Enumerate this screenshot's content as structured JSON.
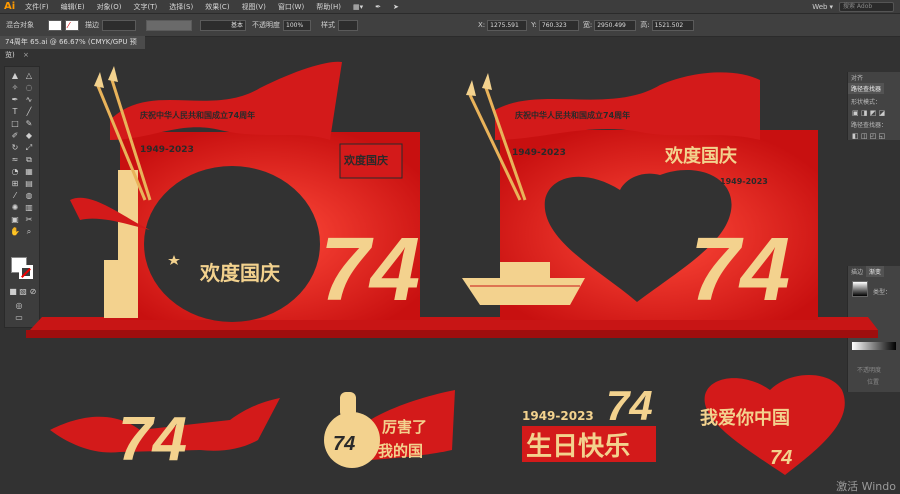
{
  "app": {
    "logo": "Ai"
  },
  "menu": [
    "文件(F)",
    "编辑(E)",
    "对象(O)",
    "文字(T)",
    "选择(S)",
    "效果(C)",
    "视图(V)",
    "窗口(W)",
    "帮助(H)"
  ],
  "workspace": {
    "label": "Web",
    "search_placeholder": "搜索 Adob"
  },
  "control_bar": {
    "group_label": "混合对象",
    "stroke_label": "描边",
    "stroke_style": "基本",
    "opacity_label": "不透明度",
    "opacity_value": "100%",
    "style_label": "样式",
    "x_value": "1275.591",
    "y_value": "760.323",
    "w_value": "2950.499",
    "h_value": "1521.502"
  },
  "document_tab": {
    "title": "74周年 65.ai @ 66.67% (CMYK/GPU 预览)",
    "close": "×"
  },
  "panels": {
    "top": {
      "tabs": [
        "对齐",
        "路径查找器"
      ],
      "shape_mode": "形状模式：",
      "pathfinder": "路径查找器："
    },
    "bottom": {
      "tabs": [
        "描边",
        "渐变"
      ],
      "type_label": "类型：",
      "opacity": "不透明度",
      "position": "位置"
    }
  },
  "art": {
    "ban1": "庆祝中华人民共和国成立74周年",
    "ban2": "1949-2023",
    "greeting": "欢度国庆",
    "number": "74",
    "dates": "1949-2023",
    "birthday": "生日快乐",
    "like1": "厉害了",
    "like2": "我的国",
    "heart_text": "我爱你中国",
    "arch_text": "欢度国庆"
  },
  "watermark": "激活 Windo",
  "colors": {
    "red": "#d31a1a",
    "cream": "#f3d28e",
    "gold": "#e9b35a",
    "bg": "#323232"
  }
}
